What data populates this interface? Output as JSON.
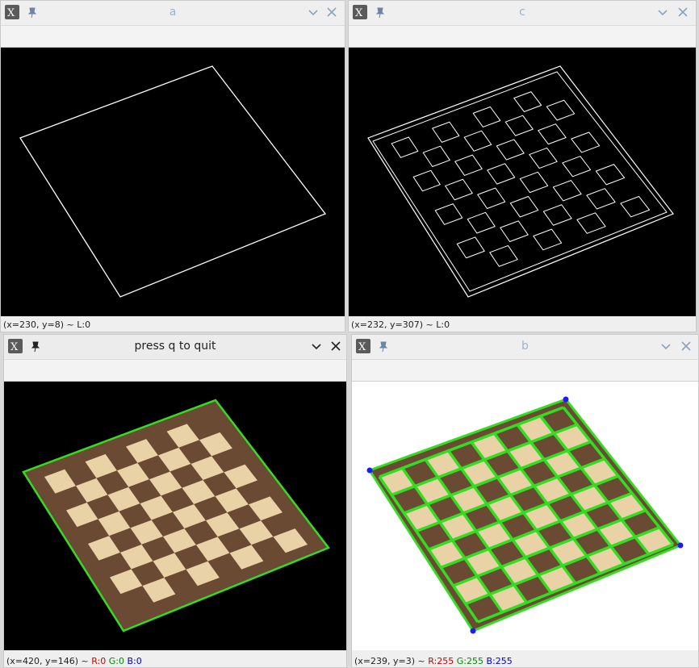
{
  "windows": {
    "a": {
      "title": "a",
      "status": {
        "coords": "(x=230, y=8)",
        "sep": "~",
        "value": "L:0"
      }
    },
    "c": {
      "title": "c",
      "status": {
        "coords": "(x=232, y=307)",
        "sep": "~",
        "value": "L:0"
      }
    },
    "quit": {
      "title": "press q to quit",
      "status": {
        "coords": "(x=420, y=146)",
        "sep": "~",
        "r": "R:0",
        "g": "G:0",
        "b": "B:0"
      }
    },
    "b": {
      "title": "b",
      "status": {
        "coords": "(x=239, y=3)",
        "sep": "~",
        "r": "R:255",
        "g": "G:255",
        "b": "B:255"
      }
    }
  },
  "colors": {
    "title_inactive": "#9fb3c8",
    "title_active": "#222222",
    "board_dark": "#6b4a33",
    "board_light": "#e8d2a6",
    "grid_green": "#33dd22",
    "corner_blue": "#1a1aff",
    "status_red": "#cc0000",
    "status_green": "#008800",
    "status_blue": "#0000cc"
  },
  "icons": [
    "app-icon",
    "pin-icon",
    "chevron-down-icon",
    "close-icon"
  ]
}
